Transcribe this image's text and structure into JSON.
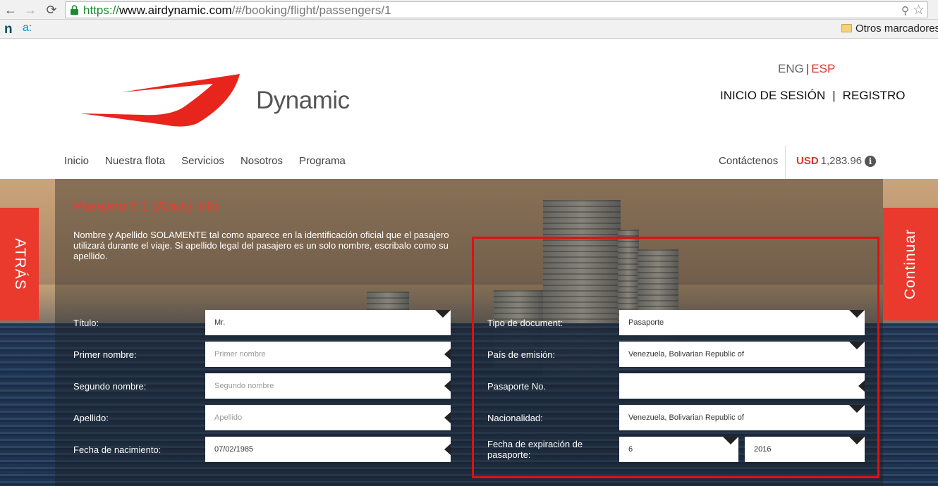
{
  "browser": {
    "url_scheme": "https://",
    "url_host": "www.airdynamic.com",
    "url_path": "/#/booking/flight/passengers/1",
    "bookmark_n": "n",
    "bookmark_a": "a:",
    "bookmark_folder": "Otros marcadores"
  },
  "header": {
    "brand": "Dynamic",
    "lang_en": "ENG",
    "lang_sep": "|",
    "lang_es": "ESP",
    "login": "INICIO DE SESIÓN",
    "account_sep": "|",
    "register": "REGISTRO",
    "nav": [
      "Inicio",
      "Nuestra flota",
      "Servicios",
      "Nosotros",
      "Programa"
    ],
    "contact": "Contáctenos",
    "currency": "USD",
    "amount": "1,283.96",
    "info_glyph": "i"
  },
  "side": {
    "back": "ATRÁS",
    "next": "Continuar"
  },
  "passenger": {
    "title": "Pasajero # 1 (Adult) Info",
    "description": "Nombre y Apellido SOLAMENTE tal como aparece en la identificación oficial que el pasajero utilizará durante el viaje. Si apellido legal del pasajero es un solo nombre, escribalo como su apellido.",
    "fields": {
      "title_label": "Título:",
      "title_value": "Mr.",
      "first_label": "Primer nombre:",
      "first_placeholder": "Primer nombre",
      "middle_label": "Segundo nombre:",
      "middle_placeholder": "Segundo nombre",
      "last_label": "Apellido:",
      "last_placeholder": "Apellido",
      "dob_label": "Fecha de nacimiento:",
      "dob_value": "07/02/1985"
    },
    "document": {
      "type_label": "Tipo de document:",
      "type_value": "Pasaporte",
      "country_label": "País de emisión:",
      "country_value": "Venezuela, Bolivarian Republic of",
      "passport_label": "Pasaporte No.",
      "passport_value": "",
      "nationality_label": "Nacionalidad:",
      "nationality_value": "Venezuela, Bolivarian Republic of",
      "expiry_label": "Fecha de expiración de pasaporte:",
      "expiry_month": "6",
      "expiry_year": "2016"
    }
  },
  "colors": {
    "accent": "#ea3a2e",
    "highlight": "#e01010"
  }
}
